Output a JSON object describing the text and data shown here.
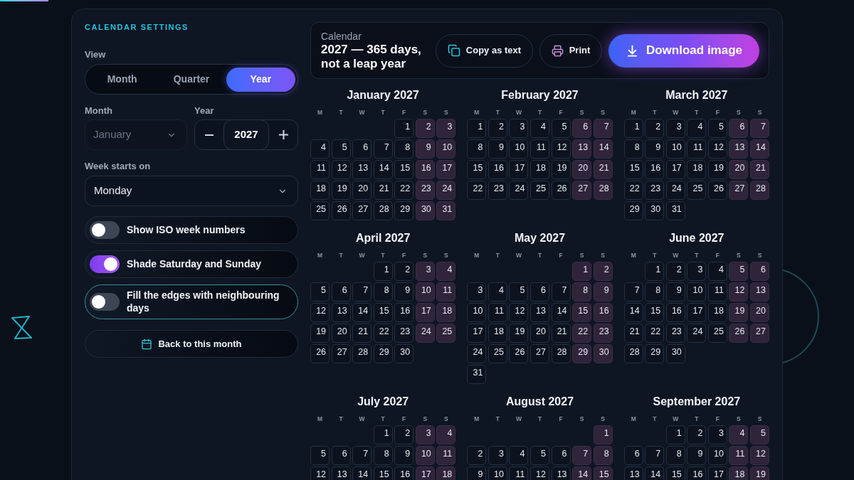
{
  "scroll_progress": {
    "level": 0.057
  },
  "settings": {
    "heading": "CALENDAR SETTINGS",
    "view": {
      "label": "View",
      "options": [
        {
          "label": "Month",
          "selected": false
        },
        {
          "label": "Quarter",
          "selected": false
        },
        {
          "label": "Year",
          "selected": true
        }
      ]
    },
    "month": {
      "label": "Month",
      "value": "January",
      "disabled": true
    },
    "year": {
      "label": "Year",
      "value": "2027"
    },
    "week_start": {
      "label": "Week starts on",
      "value": "Monday"
    },
    "toggles": {
      "iso_week_numbers": {
        "label": "Show ISO week numbers",
        "on": false,
        "focused": false
      },
      "shade_weekends": {
        "label": "Shade Saturday and Sunday",
        "on": true,
        "focused": false
      },
      "fill_edges": {
        "label": "Fill the edges with neighbouring days",
        "on": false,
        "focused": true
      }
    },
    "back_button": {
      "label": "Back to this month"
    }
  },
  "header": {
    "label": "Calendar",
    "title": "2027 — 365 days, not a leap year",
    "actions": [
      {
        "kind": "copy",
        "label": "Copy as text"
      },
      {
        "kind": "print",
        "label": "Print"
      },
      {
        "kind": "download",
        "label": "Download image"
      }
    ]
  },
  "months": [
    {
      "title": "January 2027",
      "weekdays": [
        "M",
        "T",
        "W",
        "T",
        "F",
        "S",
        "S"
      ],
      "weeks": [
        [
          "1",
          "2",
          "3"
        ],
        [
          "4",
          "5",
          "6",
          "7",
          "8",
          "9",
          "10"
        ],
        [
          "11",
          "12",
          "13",
          "14",
          "15",
          "16",
          "17"
        ],
        [
          "18",
          "19",
          "20",
          "21",
          "22",
          "23",
          "24"
        ],
        [
          "25",
          "26",
          "27",
          "28",
          "29",
          "30",
          "31"
        ]
      ]
    },
    {
      "title": "February 2027",
      "weekdays": [
        "M",
        "T",
        "W",
        "T",
        "F",
        "S",
        "S"
      ],
      "weeks": [
        [
          "1",
          "2",
          "3",
          "4",
          "5",
          "6",
          "7"
        ],
        [
          "8",
          "9",
          "10",
          "11",
          "12",
          "13",
          "14"
        ],
        [
          "15",
          "16",
          "17",
          "18",
          "19",
          "20",
          "21"
        ],
        [
          "22",
          "23",
          "24",
          "25",
          "26",
          "27",
          "28"
        ]
      ]
    },
    {
      "title": "March 2027",
      "weekdays": [
        "M",
        "T",
        "W",
        "T",
        "F",
        "S",
        "S"
      ],
      "weeks": [
        [
          "1",
          "2",
          "3",
          "4",
          "5",
          "6",
          "7"
        ],
        [
          "8",
          "9",
          "10",
          "11",
          "12",
          "13",
          "14"
        ],
        [
          "15",
          "16",
          "17",
          "18",
          "19",
          "20",
          "21"
        ],
        [
          "22",
          "23",
          "24",
          "25",
          "26",
          "27",
          "28"
        ],
        [
          "29",
          "30",
          "31"
        ]
      ]
    },
    {
      "title": "April 2027",
      "weekdays": [
        "M",
        "T",
        "W",
        "T",
        "F",
        "S",
        "S"
      ],
      "weeks": [
        [
          "1",
          "2",
          "3",
          "4"
        ],
        [
          "5",
          "6",
          "7",
          "8",
          "9",
          "10",
          "11"
        ],
        [
          "12",
          "13",
          "14",
          "15",
          "16",
          "17",
          "18"
        ],
        [
          "19",
          "20",
          "21",
          "22",
          "23",
          "24",
          "25"
        ],
        [
          "26",
          "27",
          "28",
          "29",
          "30"
        ]
      ]
    },
    {
      "title": "May 2027",
      "weekdays": [
        "M",
        "T",
        "W",
        "T",
        "F",
        "S",
        "S"
      ],
      "weeks": [
        [
          "1",
          "2"
        ],
        [
          "3",
          "4",
          "5",
          "6",
          "7",
          "8",
          "9"
        ],
        [
          "10",
          "11",
          "12",
          "13",
          "14",
          "15",
          "16"
        ],
        [
          "17",
          "18",
          "19",
          "20",
          "21",
          "22",
          "23"
        ],
        [
          "24",
          "25",
          "26",
          "27",
          "28",
          "29",
          "30"
        ],
        [
          "31"
        ]
      ]
    },
    {
      "title": "June 2027",
      "weekdays": [
        "M",
        "T",
        "W",
        "T",
        "F",
        "S",
        "S"
      ],
      "weeks": [
        [
          "1",
          "2",
          "3",
          "4",
          "5",
          "6"
        ],
        [
          "7",
          "8",
          "9",
          "10",
          "11",
          "12",
          "13"
        ],
        [
          "14",
          "15",
          "16",
          "17",
          "18",
          "19",
          "20"
        ],
        [
          "21",
          "22",
          "23",
          "24",
          "25",
          "26",
          "27"
        ],
        [
          "28",
          "29",
          "30"
        ]
      ]
    },
    {
      "title": "July 2027",
      "weekdays": [
        "M",
        "T",
        "W",
        "T",
        "F",
        "S",
        "S"
      ],
      "weeks": [
        [
          "1",
          "2",
          "3",
          "4"
        ],
        [
          "5",
          "6",
          "7",
          "8",
          "9",
          "10",
          "11"
        ],
        [
          "12",
          "13",
          "14",
          "15",
          "16",
          "17",
          "18"
        ]
      ]
    },
    {
      "title": "August 2027",
      "weekdays": [
        "M",
        "T",
        "W",
        "T",
        "F",
        "S",
        "S"
      ],
      "weeks": [
        [
          "1"
        ],
        [
          "2",
          "3",
          "4",
          "5",
          "6",
          "7",
          "8"
        ],
        [
          "9",
          "10",
          "11",
          "12",
          "13",
          "14",
          "15"
        ]
      ]
    },
    {
      "title": "September 2027",
      "weekdays": [
        "M",
        "T",
        "W",
        "T",
        "F",
        "S",
        "S"
      ],
      "weeks": [
        [
          "1",
          "2",
          "3",
          "4",
          "5"
        ],
        [
          "6",
          "7",
          "8",
          "9",
          "10",
          "11",
          "12"
        ],
        [
          "13",
          "14",
          "15",
          "16",
          "17",
          "18",
          "19"
        ]
      ]
    }
  ]
}
